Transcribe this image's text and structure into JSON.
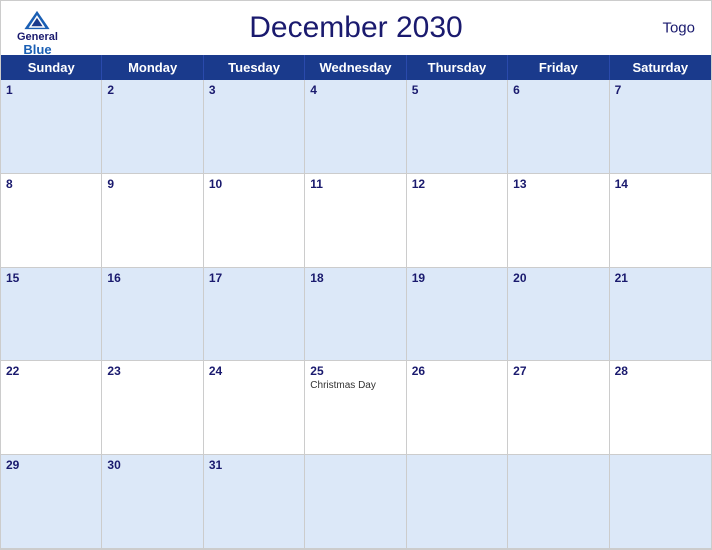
{
  "header": {
    "title": "December 2030",
    "country": "Togo",
    "logo": {
      "general": "General",
      "blue": "Blue"
    }
  },
  "days": [
    "Sunday",
    "Monday",
    "Tuesday",
    "Wednesday",
    "Thursday",
    "Friday",
    "Saturday"
  ],
  "weeks": [
    [
      {
        "date": "1",
        "event": "",
        "blue": true
      },
      {
        "date": "2",
        "event": "",
        "blue": true
      },
      {
        "date": "3",
        "event": "",
        "blue": true
      },
      {
        "date": "4",
        "event": "",
        "blue": true
      },
      {
        "date": "5",
        "event": "",
        "blue": true
      },
      {
        "date": "6",
        "event": "",
        "blue": true
      },
      {
        "date": "7",
        "event": "",
        "blue": true
      }
    ],
    [
      {
        "date": "8",
        "event": "",
        "blue": false
      },
      {
        "date": "9",
        "event": "",
        "blue": false
      },
      {
        "date": "10",
        "event": "",
        "blue": false
      },
      {
        "date": "11",
        "event": "",
        "blue": false
      },
      {
        "date": "12",
        "event": "",
        "blue": false
      },
      {
        "date": "13",
        "event": "",
        "blue": false
      },
      {
        "date": "14",
        "event": "",
        "blue": false
      }
    ],
    [
      {
        "date": "15",
        "event": "",
        "blue": true
      },
      {
        "date": "16",
        "event": "",
        "blue": true
      },
      {
        "date": "17",
        "event": "",
        "blue": true
      },
      {
        "date": "18",
        "event": "",
        "blue": true
      },
      {
        "date": "19",
        "event": "",
        "blue": true
      },
      {
        "date": "20",
        "event": "",
        "blue": true
      },
      {
        "date": "21",
        "event": "",
        "blue": true
      }
    ],
    [
      {
        "date": "22",
        "event": "",
        "blue": false
      },
      {
        "date": "23",
        "event": "",
        "blue": false
      },
      {
        "date": "24",
        "event": "",
        "blue": false
      },
      {
        "date": "25",
        "event": "Christmas Day",
        "blue": false
      },
      {
        "date": "26",
        "event": "",
        "blue": false
      },
      {
        "date": "27",
        "event": "",
        "blue": false
      },
      {
        "date": "28",
        "event": "",
        "blue": false
      }
    ],
    [
      {
        "date": "29",
        "event": "",
        "blue": true
      },
      {
        "date": "30",
        "event": "",
        "blue": true
      },
      {
        "date": "31",
        "event": "",
        "blue": true
      },
      {
        "date": "",
        "event": "",
        "blue": true
      },
      {
        "date": "",
        "event": "",
        "blue": true
      },
      {
        "date": "",
        "event": "",
        "blue": true
      },
      {
        "date": "",
        "event": "",
        "blue": true
      }
    ]
  ]
}
